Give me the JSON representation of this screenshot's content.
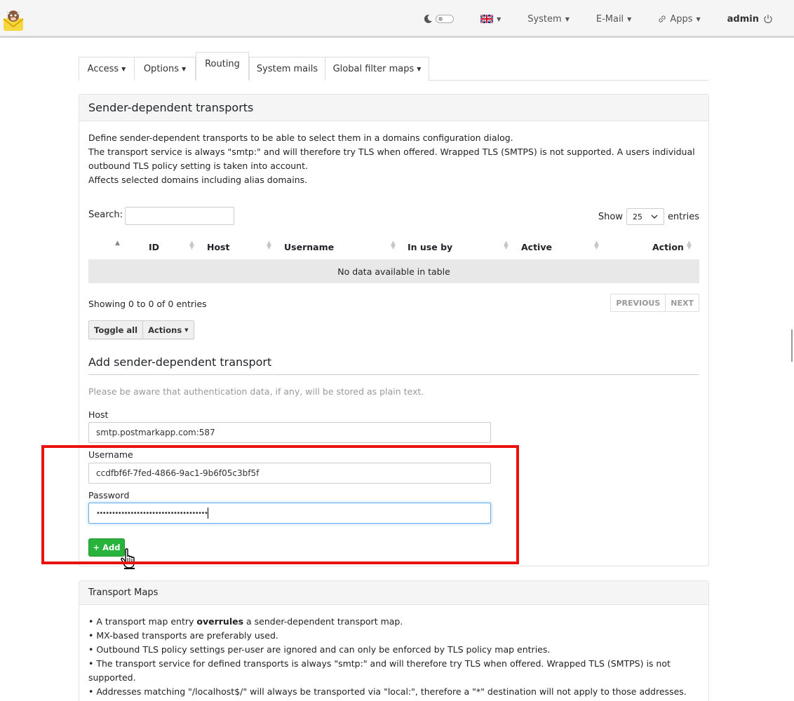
{
  "navbar": {
    "items": [
      {
        "label": "System",
        "caret": true
      },
      {
        "label": "E-Mail",
        "caret": true
      },
      {
        "label": "Apps",
        "caret": true
      }
    ],
    "user": "admin"
  },
  "tabs": [
    {
      "label": "Access",
      "caret": true
    },
    {
      "label": "Options",
      "caret": true
    },
    {
      "label": "Routing",
      "active": true
    },
    {
      "label": "System mails"
    },
    {
      "label": "Global filter maps",
      "caret": true
    }
  ],
  "sender_transports": {
    "title": "Sender-dependent transports",
    "description": [
      "Define sender-dependent transports to be able to select them in a domains configuration dialog.",
      "The transport service is always \"smtp:\" and will therefore try TLS when offered. Wrapped TLS (SMTPS) is not supported. A users individual",
      "outbound TLS policy setting is taken into account.",
      "Affects selected domains including alias domains."
    ],
    "search_label": "Search:",
    "show_label": "Show",
    "page_size": "25",
    "entries_label": "entries",
    "columns": [
      "ID",
      "Host",
      "Username",
      "In use by",
      "Active",
      "Action"
    ],
    "empty_message": "No data available in table",
    "showing": "Showing 0 to 0 of 0 entries",
    "pager": {
      "previous": "PREVIOUS",
      "next": "NEXT"
    },
    "toggle_all": "Toggle all",
    "actions": "Actions"
  },
  "add_form": {
    "title": "Add sender-dependent transport",
    "note": "Please be aware that authentication data, if any, will be stored as plain text.",
    "host_label": "Host",
    "host_value": "smtp.postmarkapp.com:587",
    "username_label": "Username",
    "username_value": "ccdfbf6f-7fed-4866-9ac1-9b6f05c3bf5f",
    "password_label": "Password",
    "password_mask": "••••••••••••••••••••••••••••••••••••",
    "add_button": "+ Add"
  },
  "transport_maps": {
    "title": "Transport Maps",
    "bullets": [
      {
        "pre": "• A transport map entry ",
        "bold": "overrules",
        "post": " a sender-dependent transport map."
      },
      {
        "pre": "• MX-based transports are preferably used.",
        "bold": "",
        "post": ""
      },
      {
        "pre": "• Outbound TLS policy settings per-user are ignored and can only be enforced by TLS policy map entries.",
        "bold": "",
        "post": ""
      },
      {
        "pre": "• The transport service for defined transports is always \"smtp:\" and will therefore try TLS when offered. Wrapped TLS (SMTPS) is not supported.",
        "bold": "",
        "post": ""
      },
      {
        "pre": "• Addresses matching \"/localhost$/\" will always be transported via \"local:\", therefore a \"*\" destination will not apply to those addresses.",
        "bold": "",
        "post": ""
      }
    ]
  },
  "colors": {
    "accent_green": "#28b43c",
    "highlight_red": "#e8130f",
    "focus_blue": "#66afe9"
  }
}
